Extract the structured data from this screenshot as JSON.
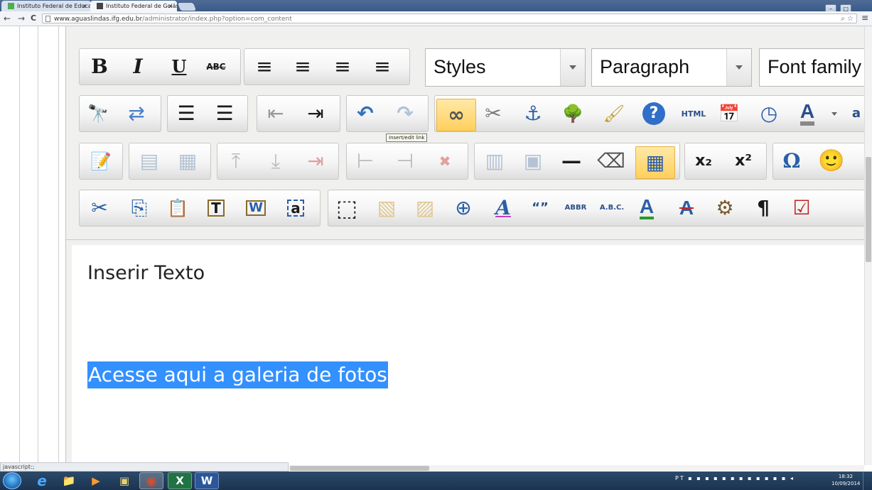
{
  "browser": {
    "tabs": [
      {
        "title": "Instituto Federal de Educa",
        "close": "×"
      },
      {
        "title": "Instituto Federal de Goiás",
        "close": "×"
      }
    ],
    "url_host": "www.aguaslindas.ifg.edu.br",
    "url_path": "/administrator/index.php?option=com_content",
    "back": "←",
    "forward": "→",
    "reload": "C",
    "menu": "≡",
    "url_icons": "⌕ ☆",
    "window_controls": {
      "minimize": "–",
      "maximize": "□",
      "close": "x"
    },
    "status_text": "javascript:;"
  },
  "editor": {
    "styles_dropdown": "Styles",
    "format_dropdown": "Paragraph",
    "font_dropdown": "Font family",
    "tooltip": "Insert/edit link",
    "row1_buttons": [
      {
        "name": "bold-button",
        "glyph": "B"
      },
      {
        "name": "italic-button",
        "glyph": "I"
      },
      {
        "name": "underline-button",
        "glyph": "U"
      },
      {
        "name": "strikethrough-button",
        "glyph": "ABC"
      },
      {
        "name": "align-left-button",
        "glyph": "≡"
      },
      {
        "name": "align-center-button",
        "glyph": "≡"
      },
      {
        "name": "align-right-button",
        "glyph": "≡"
      },
      {
        "name": "align-justify-button",
        "glyph": "≡"
      }
    ],
    "row2_buttons": [
      {
        "name": "find-button",
        "glyph": "🔭"
      },
      {
        "name": "replace-button",
        "glyph": "⇄"
      },
      {
        "name": "bullet-list-button",
        "glyph": "☰"
      },
      {
        "name": "numbered-list-button",
        "glyph": "☰"
      },
      {
        "name": "outdent-button",
        "glyph": "⇤"
      },
      {
        "name": "indent-button",
        "glyph": "⇥"
      },
      {
        "name": "undo-button",
        "glyph": "↶"
      },
      {
        "name": "redo-button",
        "glyph": "↷"
      },
      {
        "name": "insert-link-button",
        "glyph": "∞"
      },
      {
        "name": "unlink-button",
        "glyph": "✂"
      },
      {
        "name": "anchor-button",
        "glyph": "⚓"
      },
      {
        "name": "insert-image-button",
        "glyph": "🌳"
      },
      {
        "name": "cleanup-button",
        "glyph": "🖌"
      },
      {
        "name": "help-button",
        "glyph": "?"
      },
      {
        "name": "html-button",
        "glyph": "HTML"
      },
      {
        "name": "insert-date-button",
        "glyph": "📅"
      },
      {
        "name": "insert-time-button",
        "glyph": "◷"
      },
      {
        "name": "text-color-button",
        "glyph": "A"
      }
    ],
    "row3_buttons": [
      {
        "name": "edit-table-button",
        "glyph": "📝"
      },
      {
        "name": "table-row-props-button",
        "glyph": "▤"
      },
      {
        "name": "table-cell-props-button",
        "glyph": "▦"
      },
      {
        "name": "insert-row-before-button",
        "glyph": "⤒"
      },
      {
        "name": "insert-row-after-button",
        "glyph": "⤓"
      },
      {
        "name": "delete-row-button",
        "glyph": "⇥"
      },
      {
        "name": "insert-col-before-button",
        "glyph": "⊢"
      },
      {
        "name": "insert-col-after-button",
        "glyph": "⊣"
      },
      {
        "name": "delete-col-button",
        "glyph": "✖"
      },
      {
        "name": "split-cells-button",
        "glyph": "▥"
      },
      {
        "name": "merge-cells-button",
        "glyph": "▣"
      },
      {
        "name": "horizontal-rule-button",
        "glyph": "—"
      },
      {
        "name": "remove-format-button",
        "glyph": "⌫"
      },
      {
        "name": "visual-aid-button",
        "glyph": "▦"
      },
      {
        "name": "subscript-button",
        "glyph": "x₂"
      },
      {
        "name": "superscript-button",
        "glyph": "x²"
      },
      {
        "name": "special-char-button",
        "glyph": "Ω"
      },
      {
        "name": "emoticons-button",
        "glyph": "🙂"
      }
    ],
    "row4_buttons": [
      {
        "name": "cut-button",
        "glyph": "✂"
      },
      {
        "name": "copy-button",
        "glyph": "⎘"
      },
      {
        "name": "paste-button",
        "glyph": "📋"
      },
      {
        "name": "paste-text-button",
        "glyph": "T"
      },
      {
        "name": "paste-word-button",
        "glyph": "W"
      },
      {
        "name": "select-all-button",
        "glyph": "a"
      },
      {
        "name": "insert-layer-button",
        "glyph": "⬚"
      },
      {
        "name": "move-forward-button",
        "glyph": "▧"
      },
      {
        "name": "move-backward-button",
        "glyph": "▨"
      },
      {
        "name": "absolute-position-button",
        "glyph": "⊕"
      },
      {
        "name": "style-props-button",
        "glyph": "A"
      },
      {
        "name": "cite-button",
        "glyph": "“”"
      },
      {
        "name": "abbr-button",
        "glyph": "ABBR"
      },
      {
        "name": "acronym-button",
        "glyph": "A.B.C."
      },
      {
        "name": "insertion-button",
        "glyph": "A"
      },
      {
        "name": "deletion-button",
        "glyph": "A"
      },
      {
        "name": "attributes-button",
        "glyph": "⚙"
      },
      {
        "name": "show-blocks-button",
        "glyph": "¶"
      },
      {
        "name": "non-breaking-button",
        "glyph": "☑"
      }
    ]
  },
  "content": {
    "heading": "Inserir Texto",
    "selected_link": "Acesse aqui a galeria de fotos"
  },
  "taskbar": {
    "items": [
      {
        "name": "internet-explorer-icon",
        "glyph": "e"
      },
      {
        "name": "file-explorer-icon",
        "glyph": "📁"
      },
      {
        "name": "media-player-icon",
        "glyph": "▶"
      },
      {
        "name": "program-icon",
        "glyph": "▣"
      },
      {
        "name": "chrome-icon",
        "glyph": "◉"
      },
      {
        "name": "excel-icon",
        "glyph": "X"
      },
      {
        "name": "word-icon",
        "glyph": "W"
      }
    ],
    "tray_lang": "PT",
    "time": "18:32",
    "date": "10/09/2014"
  },
  "colors": {
    "selection": "#3390ff",
    "toolbar_bg": "#f0f0ee",
    "active_button": "#ffd86b",
    "taskbar": "#1f3a5a"
  }
}
